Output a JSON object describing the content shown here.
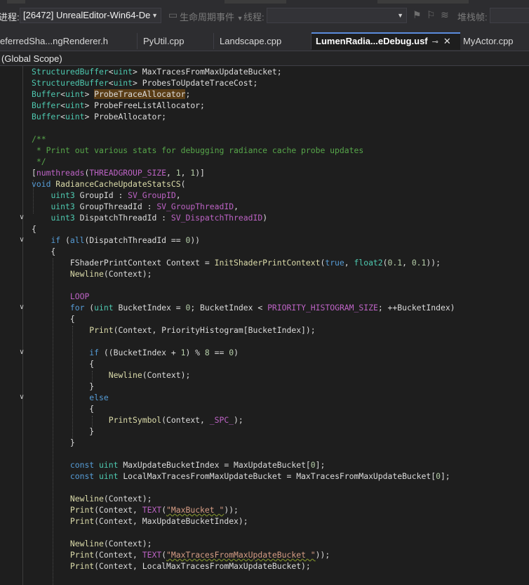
{
  "toolbar": {
    "process_label": "进程:",
    "process_value": "[26472] UnrealEditor-Win64-De",
    "lifecycle_label": "生命周期事件",
    "thread_label": "线程:",
    "stack_label": "堆栈帧:"
  },
  "tabs": [
    {
      "label": "eferredSha...ngRenderer.h"
    },
    {
      "label": "PyUtil.cpp"
    },
    {
      "label": "Landscape.cpp"
    },
    {
      "label": "LumenRadia...eDebug.usf",
      "active": true,
      "pin": "⊸",
      "close": "✕"
    },
    {
      "label": "MyActor.cpp"
    }
  ],
  "scope": "(Global Scope)",
  "code_lines": [
    "StructuredBuffer<uint> MaxTracesFromMaxUpdateBucket;",
    "StructuredBuffer<uint> ProbesToUpdateTraceCost;",
    "Buffer<uint> ProbeTraceAllocator;",
    "Buffer<uint> ProbeFreeListAllocator;",
    "Buffer<uint> ProbeAllocator;",
    "",
    "/**",
    " * Print out various stats for debugging radiance cache probe updates",
    " */",
    "[numthreads(THREADGROUP_SIZE, 1, 1)]",
    "void RadianceCacheUpdateStatsCS(",
    "    uint3 GroupId : SV_GroupID,",
    "    uint3 GroupThreadId : SV_GroupThreadID,",
    "    uint3 DispatchThreadId : SV_DispatchThreadID)",
    "{",
    "    if (all(DispatchThreadId == 0))",
    "    {",
    "        FShaderPrintContext Context = InitShaderPrintContext(true, float2(0.1, 0.1));",
    "        Newline(Context);",
    "",
    "        LOOP",
    "        for (uint BucketIndex = 0; BucketIndex < PRIORITY_HISTOGRAM_SIZE; ++BucketIndex)",
    "        {",
    "            Print(Context, PriorityHistogram[BucketIndex]);",
    "",
    "            if ((BucketIndex + 1) % 8 == 0)",
    "            {",
    "                Newline(Context);",
    "            }",
    "            else",
    "            {",
    "                PrintSymbol(Context, _SPC_);",
    "            }",
    "        }",
    "",
    "        const uint MaxUpdateBucketIndex = MaxUpdateBucket[0];",
    "        const uint LocalMaxTracesFromMaxUpdateBucket = MaxTracesFromMaxUpdateBucket[0];",
    "",
    "        Newline(Context);",
    "        Print(Context, TEXT(\"MaxBucket \"));",
    "        Print(Context, MaxUpdateBucketIndex);",
    "",
    "        Newline(Context);",
    "        Print(Context, TEXT(\"MaxTracesFromMaxUpdateBucket \"));",
    "        Print(Context, LocalMaxTracesFromMaxUpdateBucket);"
  ],
  "colors": {
    "keyword": "#569cd6",
    "type": "#4ec9b0",
    "function": "#dcdcaa",
    "macro": "#bd63c5",
    "comment": "#57a64a",
    "number": "#b5cea8",
    "string": "#d69d85",
    "active_tab_accent": "#5b8cdc"
  }
}
